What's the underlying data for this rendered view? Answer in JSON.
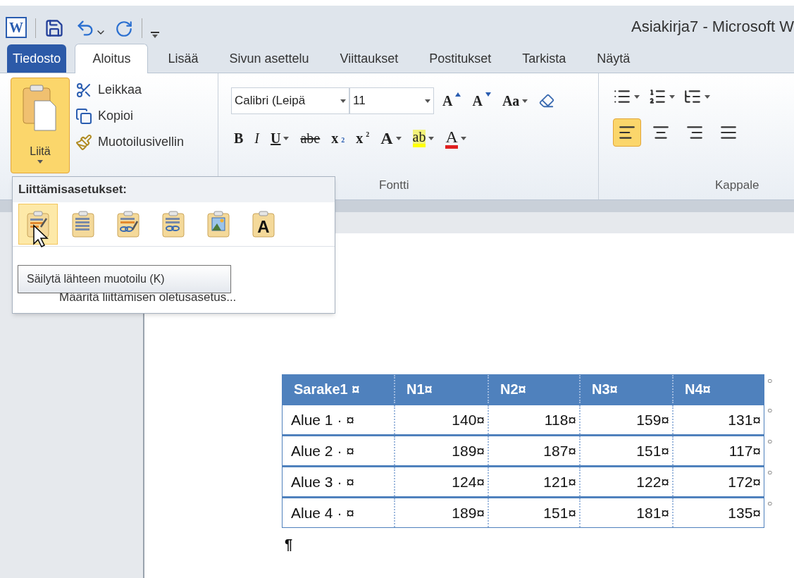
{
  "window": {
    "app_icon_letter": "W",
    "title": "Asiakirja7 - Microsoft W"
  },
  "tabs": [
    {
      "label": "Tiedosto",
      "kind": "file",
      "selected": false
    },
    {
      "label": "Aloitus",
      "kind": "tab",
      "selected": true
    },
    {
      "label": "Lisää",
      "kind": "tab",
      "selected": false
    },
    {
      "label": "Sivun asettelu",
      "kind": "tab",
      "selected": false
    },
    {
      "label": "Viittaukset",
      "kind": "tab",
      "selected": false
    },
    {
      "label": "Postitukset",
      "kind": "tab",
      "selected": false
    },
    {
      "label": "Tarkista",
      "kind": "tab",
      "selected": false
    },
    {
      "label": "Näytä",
      "kind": "tab",
      "selected": false
    }
  ],
  "clipboard": {
    "paste_label": "Liitä",
    "paste_pressed": true,
    "items": [
      {
        "label": "Leikkaa",
        "kind": "cut"
      },
      {
        "label": "Kopioi",
        "kind": "copy"
      },
      {
        "label": "Muotoilusivellin",
        "kind": "brush"
      }
    ]
  },
  "font_group": {
    "font_name": "Calibri (Leipä",
    "font_size": "11",
    "row1": [
      {
        "label": "A",
        "kind": "grow"
      },
      {
        "label": "A",
        "kind": "shrink"
      },
      {
        "label": "Aa",
        "kind": "case"
      },
      {
        "kind": "clear"
      }
    ],
    "row2": [
      {
        "label": "B",
        "kind": "bold"
      },
      {
        "label": "I",
        "kind": "italic"
      },
      {
        "label": "U",
        "kind": "underline"
      },
      {
        "label": "abe",
        "kind": "strike"
      },
      {
        "label": "x",
        "kind": "sub",
        "script": "2"
      },
      {
        "label": "x",
        "kind": "sup",
        "script": "2"
      },
      {
        "label": "A",
        "kind": "effects"
      },
      {
        "label": "ab",
        "kind": "highlight"
      },
      {
        "label": "A",
        "kind": "fontcolor"
      }
    ],
    "label": "Fontti"
  },
  "paragraph_group": {
    "align": [
      {
        "kind": "left",
        "selected": true
      },
      {
        "kind": "center",
        "selected": false
      },
      {
        "kind": "right",
        "selected": false
      },
      {
        "kind": "justify",
        "selected": false
      }
    ],
    "label": "Kappale"
  },
  "paste_menu": {
    "heading": "Liittämisasetukset:",
    "options": [
      {
        "kind": "keep",
        "selected": true
      },
      {
        "kind": "merge",
        "selected": false
      },
      {
        "kind": "linkkeep",
        "selected": false
      },
      {
        "kind": "linkmerge",
        "selected": false
      },
      {
        "kind": "picture",
        "selected": false
      },
      {
        "kind": "text",
        "selected": false,
        "label": "A"
      }
    ],
    "items": [
      "Määritä liittämisen oletusasetus..."
    ],
    "tooltip": "Säilytä lähteen muotoilu (K)"
  },
  "table": {
    "columns": [
      "Sarake1 ¤",
      "N1¤",
      "N2¤",
      "N3¤",
      "N4¤"
    ],
    "header_end_mark": "○",
    "rows": [
      {
        "cells": [
          "Alue 1 · ¤",
          "140¤",
          "118¤",
          "159¤",
          "131¤"
        ],
        "end_mark": "○"
      },
      {
        "cells": [
          "Alue 2 · ¤",
          "189¤",
          "187¤",
          "151¤",
          "117¤"
        ],
        "end_mark": "○"
      },
      {
        "cells": [
          "Alue 3 · ¤",
          "124¤",
          "121¤",
          "122¤",
          "172¤"
        ],
        "end_mark": "○"
      },
      {
        "cells": [
          "Alue 4 · ¤",
          "189¤",
          "151¤",
          "181¤",
          "135¤"
        ],
        "end_mark": "○"
      }
    ]
  },
  "paragraph_mark": "¶"
}
